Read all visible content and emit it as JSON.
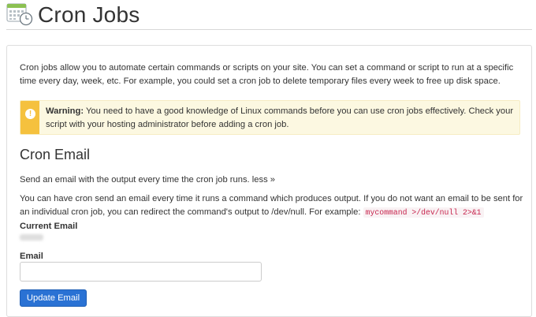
{
  "page": {
    "title": "Cron Jobs",
    "icon": "calendar-clock-icon"
  },
  "intro": {
    "text": "Cron jobs allow you to automate certain commands or scripts on your site. You can set a command or script to run at a specific time every day, week, etc. For example, you could set a cron job to delete temporary files every week to free up disk space."
  },
  "warning": {
    "icon": "exclamation-icon",
    "label": "Warning:",
    "text": " You need to have a good knowledge of Linux commands before you can use cron jobs effectively. Check your script with your hosting administrator before adding a cron job.",
    "color": "#f5c13e"
  },
  "cron_email": {
    "title": "Cron Email",
    "send_text": "Send an email with the output every time the cron job runs.",
    "less_link": "less »",
    "explain_text": "You can have cron send an email every time it runs a command which produces output. If you do not want an email to be sent for an individual cron job, you can redirect the command's output to /dev/null. For example:",
    "example_code": "mycommand >/dev/null 2>&1",
    "current_email_label": "Current Email",
    "email_label": "Email",
    "email_value": "",
    "update_button": "Update Email"
  },
  "colors": {
    "primary": "#2a72d4",
    "warning_bg": "#fcf8e1",
    "code_text": "#c7254e"
  }
}
